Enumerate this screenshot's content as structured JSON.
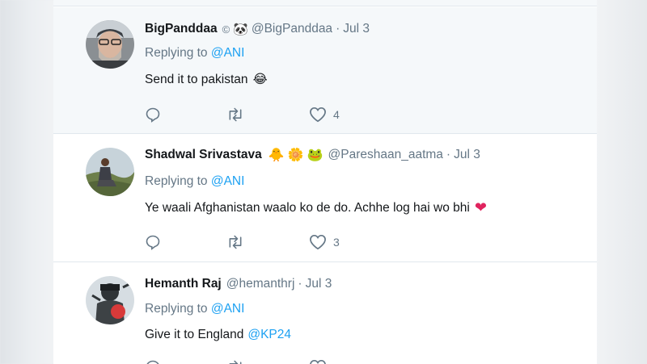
{
  "tweets": [
    {
      "name": "BigPanddaa",
      "handle": "@BigPanddaa",
      "date": "Jul 3",
      "replying_label": "Replying to",
      "replying_to": "@ANI",
      "text": "Send it to pakistan",
      "text_emoji": "😂",
      "name_badges": [
        "©",
        "🐼"
      ],
      "like_count": "4",
      "avatar_icon": "man-with-glasses-avatar"
    },
    {
      "name": "Shadwal Srivastava",
      "handle": "@Pareshaan_aatma",
      "date": "Jul 3",
      "replying_label": "Replying to",
      "replying_to": "@ANI",
      "text": "Ye waali Afghanistan waalo ko de do. Achhe log hai wo bhi",
      "text_emoji": "❤",
      "name_badges": [
        "🐥",
        "🌼",
        "🐸"
      ],
      "like_count": "3",
      "avatar_icon": "man-on-hill-avatar"
    },
    {
      "name": "Hemanth Raj",
      "handle": "@hemanthrj",
      "date": "Jul 3",
      "replying_label": "Replying to",
      "replying_to": "@ANI",
      "text": "Give it to England",
      "text_mention": "@KP24",
      "avatar_icon": "illustrated-character-avatar"
    }
  ],
  "colors": {
    "link": "#1da1f2",
    "secondary_text": "#657786",
    "primary_text": "#14171a",
    "heart_red": "#e0245e"
  },
  "action_icons": [
    "reply-icon",
    "retweet-icon",
    "like-icon"
  ]
}
